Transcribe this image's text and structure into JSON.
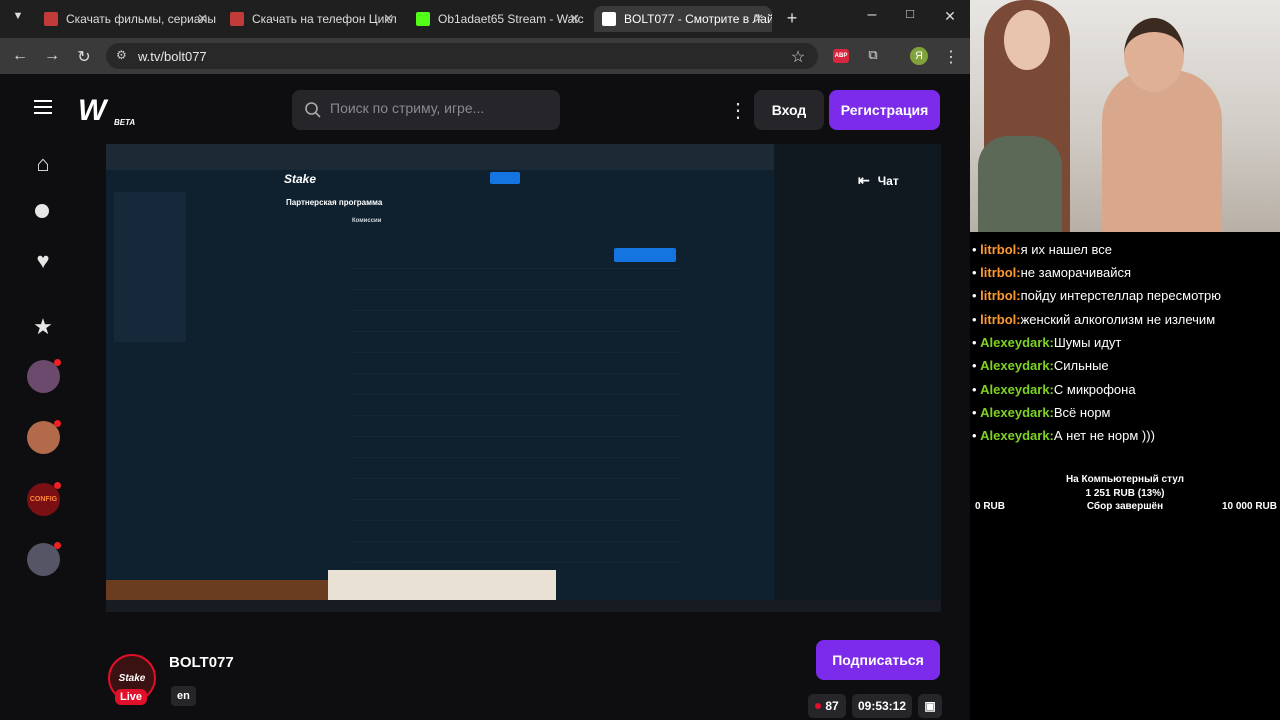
{
  "browser": {
    "tabs": [
      {
        "title": "Скачать фильмы, сериалы",
        "fav_color": "#c23b3b"
      },
      {
        "title": "Скачать на телефон Цикл",
        "fav_color": "#c23b3b"
      },
      {
        "title": "Ob1adaet65 Stream - Watc",
        "fav_color": "#53fc18"
      },
      {
        "title": "BOLT077 - Смотрите в Лай",
        "fav_color": "#222222"
      }
    ],
    "url": "w.tv/bolt077",
    "profile_letter": "Я",
    "extension_badge": "ABP"
  },
  "site": {
    "logo": "W",
    "logo_beta": "BETA",
    "search_placeholder": "Поиск по стриму, игре...",
    "login_label": "Вход",
    "register_label": "Регистрация",
    "accent": "#7c2bea",
    "sidebar_avatars": [
      {
        "name": "avatar-1",
        "color": "#6b4a6e"
      },
      {
        "name": "avatar-2",
        "color": "#b26a4a"
      },
      {
        "name": "config",
        "color": "#7a0f14",
        "label": "CONFIG"
      },
      {
        "name": "avatar-4",
        "color": "#556"
      }
    ]
  },
  "player": {
    "chat_label": "Чат",
    "inner_title": "Партнерская программа",
    "inner_brand": "Stake",
    "inner_heading": "Комиссии"
  },
  "streamer": {
    "name": "BOLT077",
    "avatar_text": "Stake",
    "live_label": "Live",
    "language": "en",
    "subscribe_label": "Подписаться",
    "viewers": "87",
    "uptime": "09:53:12"
  },
  "overlay_chat": {
    "messages": [
      {
        "nick": "litrbol:",
        "text": "я их нашел все"
      },
      {
        "nick": "litrbol:",
        "text": "не заморачивайся"
      },
      {
        "nick": "litrbol:",
        "text": "пойду интерстеллар пересмотрю"
      },
      {
        "nick": "litrbol:",
        "text": "женский алкоголизм не излечим"
      },
      {
        "nick": "Alexeydark:",
        "text": "Шумы идут"
      },
      {
        "nick": "Alexeydark:",
        "text": "Сильные"
      },
      {
        "nick": "Alexeydark:",
        "text": "С микрофона"
      },
      {
        "nick": "Alexeydark:",
        "text": "Всё норм"
      },
      {
        "nick": "Alexeydark:",
        "text": "А нет не норм )))"
      }
    ]
  },
  "donation_goal": {
    "title": "На Компьютерный стул",
    "amount": "1 251 RUB (13%)",
    "progress": 0.13,
    "min": "0 RUB",
    "status": "Сбор завершён",
    "max": "10 000 RUB"
  }
}
